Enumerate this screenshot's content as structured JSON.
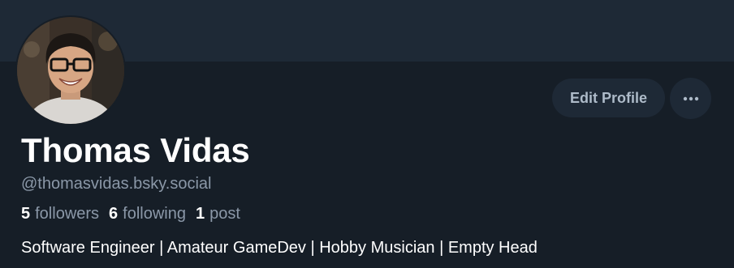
{
  "profile": {
    "display_name": "Thomas Vidas",
    "handle": "@thomasvidas.bsky.social",
    "bio": "Software Engineer | Amateur GameDev | Hobby Musician | Empty Head",
    "avatar_icon": "profile-photo"
  },
  "stats": {
    "followers_count": "5",
    "followers_label": "followers",
    "following_count": "6",
    "following_label": "following",
    "posts_count": "1",
    "posts_label": "post"
  },
  "actions": {
    "edit_profile_label": "Edit Profile",
    "more_icon": "ellipsis-icon"
  },
  "colors": {
    "background": "#161e27",
    "banner": "#1e2936",
    "button_bg": "#1e2936",
    "muted_text": "#8b98a8"
  }
}
